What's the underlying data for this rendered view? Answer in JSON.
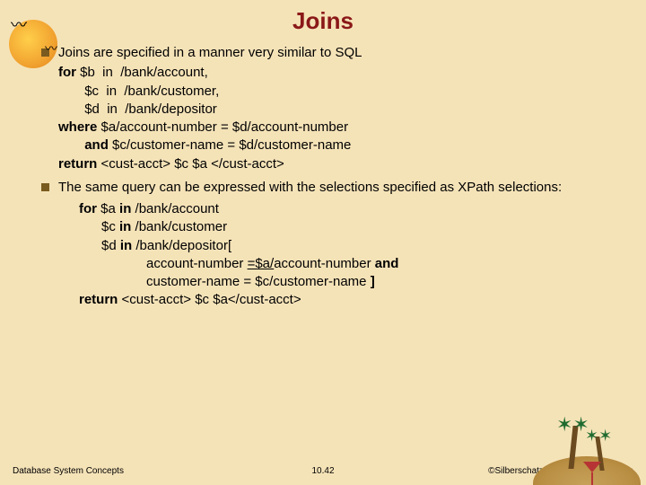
{
  "title": "Joins",
  "bullets": {
    "b1": "Joins are specified in a manner very similar to SQL",
    "b2": "The same query can be expressed with the selections specified as XPath selections:"
  },
  "code1": {
    "l1": {
      "kw": "for",
      "rest": " $b  in  /bank/account,"
    },
    "l2": {
      "indent": "       ",
      "rest": "$c  in  /bank/customer,"
    },
    "l3": {
      "indent": "       ",
      "rest": "$d  in  /bank/depositor"
    },
    "l4": {
      "kw": "where",
      "rest": " $a/account-number = $d/account-number"
    },
    "l5": {
      "indent": "       ",
      "kw": "and",
      "rest": " $c/customer-name = $d/customer-name"
    },
    "l6": {
      "kw": "return",
      "rest": " <cust-acct> $c $a </cust-acct>"
    }
  },
  "code2": {
    "l1": {
      "kw": "for",
      "rest": " $a ",
      "kw2": "in",
      "rest2": " /bank/account"
    },
    "l2": {
      "indent": "      $c ",
      "kw": "in",
      "rest": " /bank/customer"
    },
    "l3": {
      "indent": "      $d ",
      "kw": "in",
      "rest": " /bank/depositor["
    },
    "l4": {
      "indent": "                  account-number ",
      "eq_ul": "=$a/",
      "rest": "account-number ",
      "kw": "and"
    },
    "l5": {
      "indent": "                  customer-name = $c/customer-name",
      "rest": " ]"
    },
    "l6": {
      "kw": "return",
      "rest": " <cust-acct> $c $a</cust-acct>"
    }
  },
  "footer": {
    "left": "Database System Concepts",
    "mid": "10.42",
    "right": "©Silberschatz, Korth and Sudarshan"
  }
}
